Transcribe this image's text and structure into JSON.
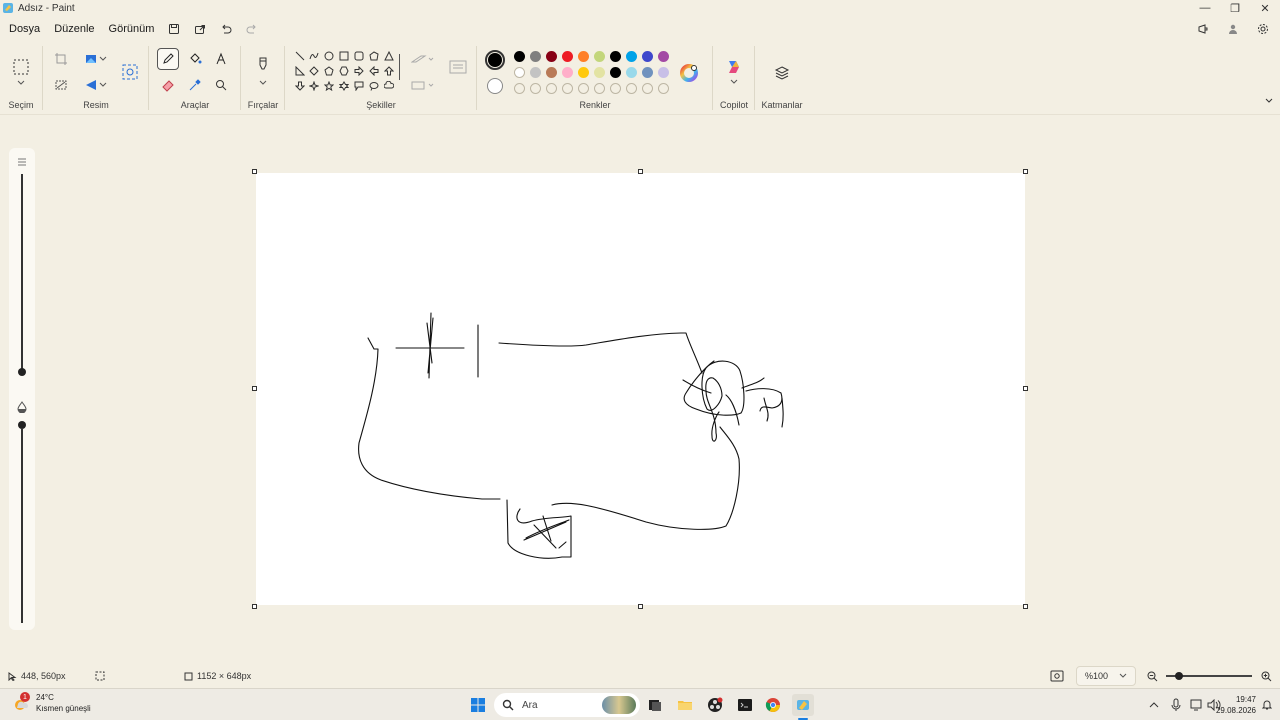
{
  "window": {
    "title": "Adsız - Paint",
    "minimize": "—",
    "restore": "❐",
    "close": "✕"
  },
  "menu": {
    "items": [
      "Dosya",
      "Düzenle",
      "Görünüm"
    ]
  },
  "ribbon": {
    "groups": {
      "selection": "Seçim",
      "image": "Resim",
      "tools": "Araçlar",
      "brushes": "Fırçalar",
      "shapes": "Şekiller",
      "colors": "Renkler",
      "copilot": "Copilot",
      "layers": "Katmanlar"
    },
    "active_tool": "pencil",
    "primary_color": "#000000",
    "secondary_color": "#ffffff",
    "palette_row1": [
      "#000000",
      "#7f7f7f",
      "#880015",
      "#ed1c24",
      "#ff7f27",
      "#c3d67b",
      "#000000",
      "#00a2e8",
      "#3f48cc",
      "#a349a4"
    ],
    "palette_row2": [
      "#ffffff",
      "#c3c3c3",
      "#b97a57",
      "#ffaec9",
      "#ffc90e",
      "#e3e3a3",
      "#000000",
      "#99d9ea",
      "#7092be",
      "#c8bfe7"
    ]
  },
  "status": {
    "cursor_position": "448, 560px",
    "canvas_size": "1152 × 648px",
    "zoom": "%100"
  },
  "taskbar": {
    "weather_temp": "24°C",
    "weather_desc": "Kısmen güneşli",
    "weather_badge": "1",
    "search_label": "Ara",
    "time": "19:47",
    "date": "29.08.2026"
  }
}
